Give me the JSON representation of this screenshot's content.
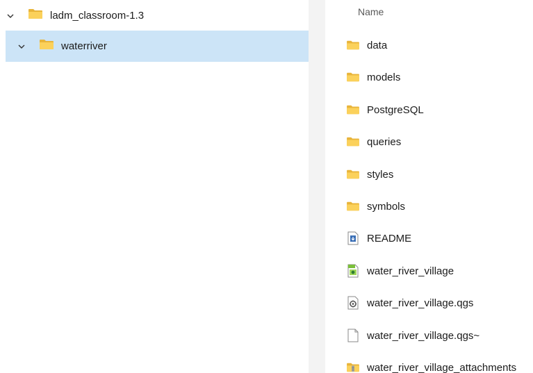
{
  "nav": {
    "items": [
      {
        "label": "ladm_classroom-1.3",
        "expanded": true,
        "selected": false,
        "icon": "folder-icon"
      },
      {
        "label": "waterriver",
        "expanded": true,
        "selected": true,
        "icon": "folder-icon"
      }
    ]
  },
  "file_list": {
    "column_header": "Name",
    "items": [
      {
        "name": "data",
        "type": "folder",
        "icon": "folder-icon"
      },
      {
        "name": "models",
        "type": "folder",
        "icon": "folder-icon"
      },
      {
        "name": "PostgreSQL",
        "type": "folder",
        "icon": "folder-icon"
      },
      {
        "name": "queries",
        "type": "folder",
        "icon": "folder-icon"
      },
      {
        "name": "styles",
        "type": "folder",
        "icon": "folder-icon"
      },
      {
        "name": "symbols",
        "type": "folder",
        "icon": "folder-icon"
      },
      {
        "name": "README",
        "type": "document",
        "icon": "readme-file-icon"
      },
      {
        "name": "water_river_village",
        "type": "image",
        "icon": "image-file-icon"
      },
      {
        "name": "water_river_village.qgs",
        "type": "project",
        "icon": "settings-file-icon"
      },
      {
        "name": "water_river_village.qgs~",
        "type": "file",
        "icon": "blank-file-icon"
      },
      {
        "name": "water_river_village_attachments",
        "type": "zip-folder",
        "icon": "zip-folder-icon"
      }
    ]
  },
  "colors": {
    "selection": "#cce4f7",
    "folder": "#f8c94a",
    "splitter": "#f3f3f3"
  }
}
